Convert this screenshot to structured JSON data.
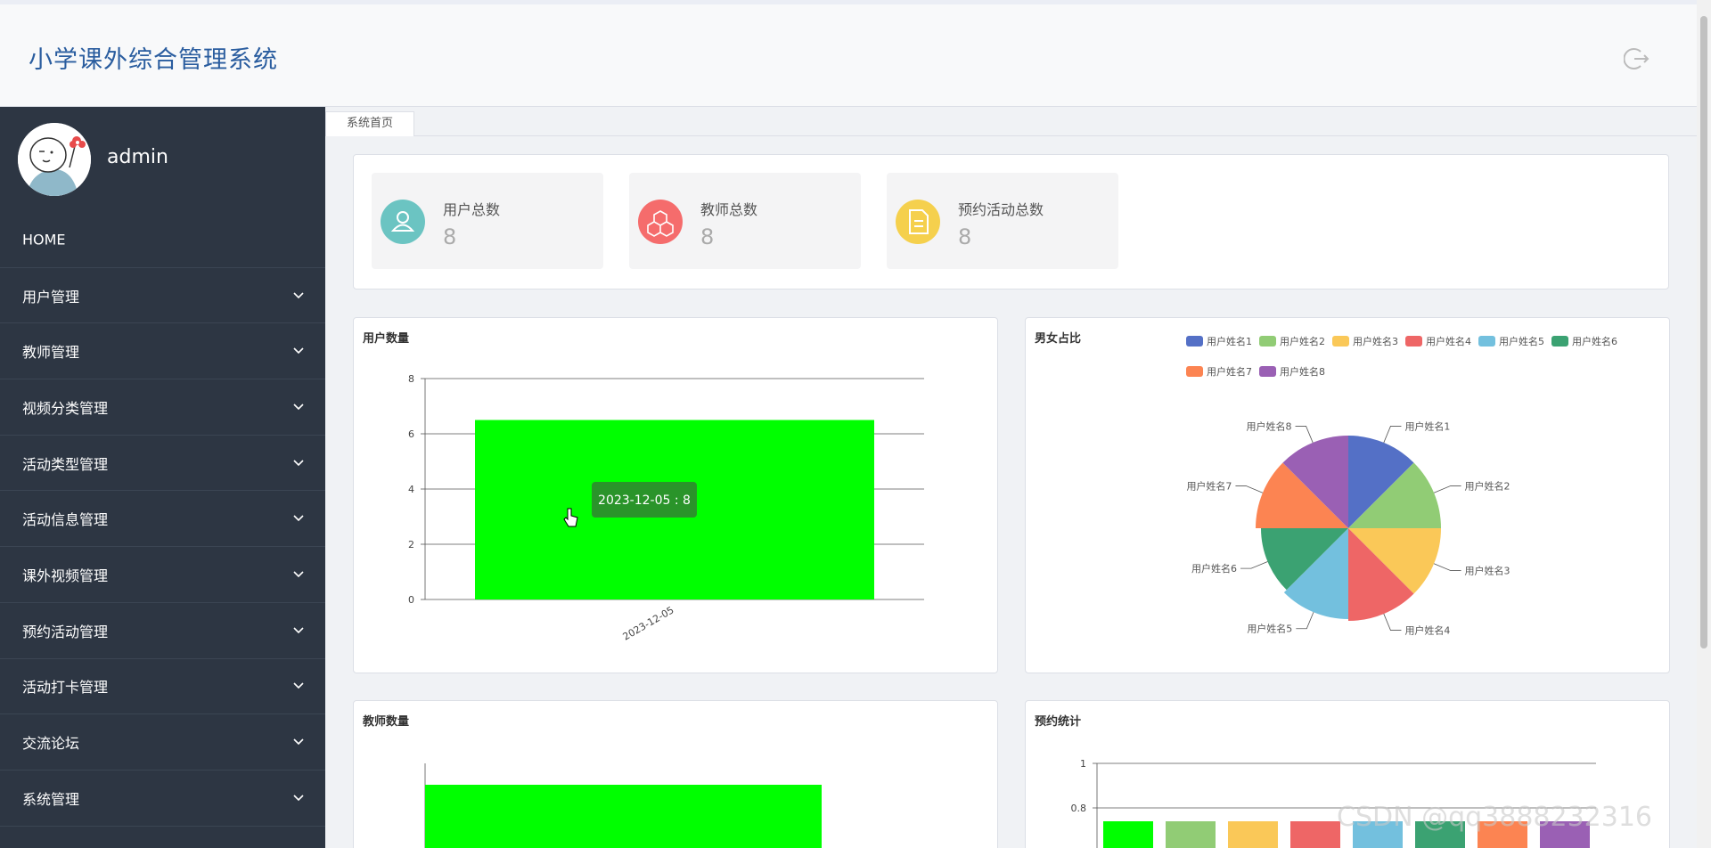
{
  "header": {
    "title": "小学课外综合管理系统",
    "logout_icon": "logout-icon"
  },
  "user": {
    "name": "admin"
  },
  "sidebar": {
    "items": [
      {
        "label": "HOME",
        "has_children": false
      },
      {
        "label": "用户管理",
        "has_children": true
      },
      {
        "label": "教师管理",
        "has_children": true
      },
      {
        "label": "视频分类管理",
        "has_children": true
      },
      {
        "label": "活动类型管理",
        "has_children": true
      },
      {
        "label": "活动信息管理",
        "has_children": true
      },
      {
        "label": "课外视频管理",
        "has_children": true
      },
      {
        "label": "预约活动管理",
        "has_children": true
      },
      {
        "label": "活动打卡管理",
        "has_children": true
      },
      {
        "label": "交流论坛",
        "has_children": true
      },
      {
        "label": "系统管理",
        "has_children": true
      }
    ]
  },
  "tabs": [
    {
      "label": "系统首页"
    }
  ],
  "stats": [
    {
      "label": "用户总数",
      "value": "8",
      "color": "#6bc4c2",
      "icon": "user-icon"
    },
    {
      "label": "教师总数",
      "value": "8",
      "color": "#f56c6c",
      "icon": "cubes-icon"
    },
    {
      "label": "预约活动总数",
      "value": "8",
      "color": "#f5d04d",
      "icon": "document-icon"
    }
  ],
  "chart_data": [
    {
      "type": "bar",
      "title": "用户数量",
      "categories": [
        "2023-12-05"
      ],
      "values": [
        6.5
      ],
      "ylim": [
        0,
        8
      ],
      "yticks": [
        0,
        2,
        4,
        6,
        8
      ],
      "color": "#00ff00",
      "tooltip": "2023-12-05 : 8"
    },
    {
      "type": "pie",
      "title": "男女占比",
      "labels": [
        "用户姓名1",
        "用户姓名2",
        "用户姓名3",
        "用户姓名4",
        "用户姓名5",
        "用户姓名6",
        "用户姓名7",
        "用户姓名8"
      ],
      "values": [
        1,
        1,
        1,
        1,
        1,
        1,
        1,
        1
      ],
      "colors": [
        "#5470c6",
        "#91cc75",
        "#fac858",
        "#ee6666",
        "#73c0de",
        "#3ba272",
        "#fc8452",
        "#9a60b4"
      ],
      "legend_position": "top-right"
    },
    {
      "type": "bar",
      "title": "教师数量",
      "color": "#00ff00"
    },
    {
      "type": "bar",
      "title": "预约统计",
      "yticks_visible": [
        1,
        0.8
      ],
      "colors": [
        "#00ff00",
        "#91cc75",
        "#fac858",
        "#ee6666",
        "#73c0de",
        "#3ba272",
        "#fc8452",
        "#9a60b4"
      ]
    }
  ],
  "watermark": "CSDN @qq3888232316"
}
